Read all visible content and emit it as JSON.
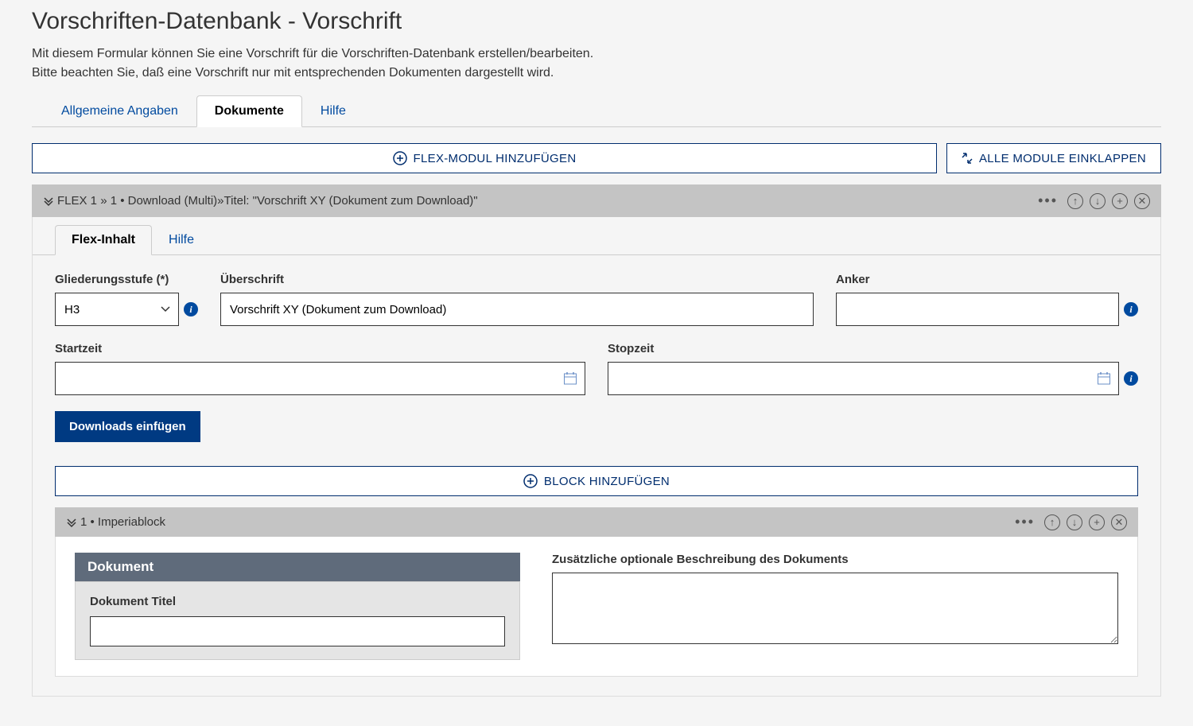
{
  "page": {
    "title": "Vorschriften-Datenbank - Vorschrift",
    "desc_line1": "Mit diesem Formular können Sie eine Vorschrift für die Vorschriften-Datenbank erstellen/bearbeiten.",
    "desc_line2": "Bitte beachten Sie, daß eine Vorschrift nur mit entsprechenden Dokumenten dargestellt wird."
  },
  "top_tabs": {
    "allgemeine": "Allgemeine Angaben",
    "dokumente": "Dokumente",
    "hilfe": "Hilfe"
  },
  "buttons": {
    "flex_add": "FLEX-MODUL HINZUFÜGEN",
    "collapse_all": "ALLE MODULE EINKLAPPEN",
    "downloads_insert": "Downloads einfügen",
    "block_add": "BLOCK HINZUFÜGEN"
  },
  "flex_header": {
    "text": "FLEX 1 »  1 • Download (Multi)»Titel: \"Vorschrift XY (Dokument zum Download)\""
  },
  "inner_tabs": {
    "flex_inhalt": "Flex-Inhalt",
    "hilfe": "Hilfe"
  },
  "form": {
    "gliederungsstufe": {
      "label": "Gliederungsstufe (*)",
      "value": "H3"
    },
    "ueberschrift": {
      "label": "Überschrift",
      "value": "Vorschrift XY (Dokument zum Download)"
    },
    "anker": {
      "label": "Anker",
      "value": ""
    },
    "startzeit": {
      "label": "Startzeit",
      "value": ""
    },
    "stopzeit": {
      "label": "Stopzeit",
      "value": ""
    }
  },
  "sub_block": {
    "header": "1 • Imperiablock",
    "doc_header": "Dokument",
    "doc_title_label": "Dokument Titel",
    "doc_title_value": "",
    "right_label": "Zusätzliche optionale Beschreibung des Dokuments",
    "right_value": ""
  }
}
